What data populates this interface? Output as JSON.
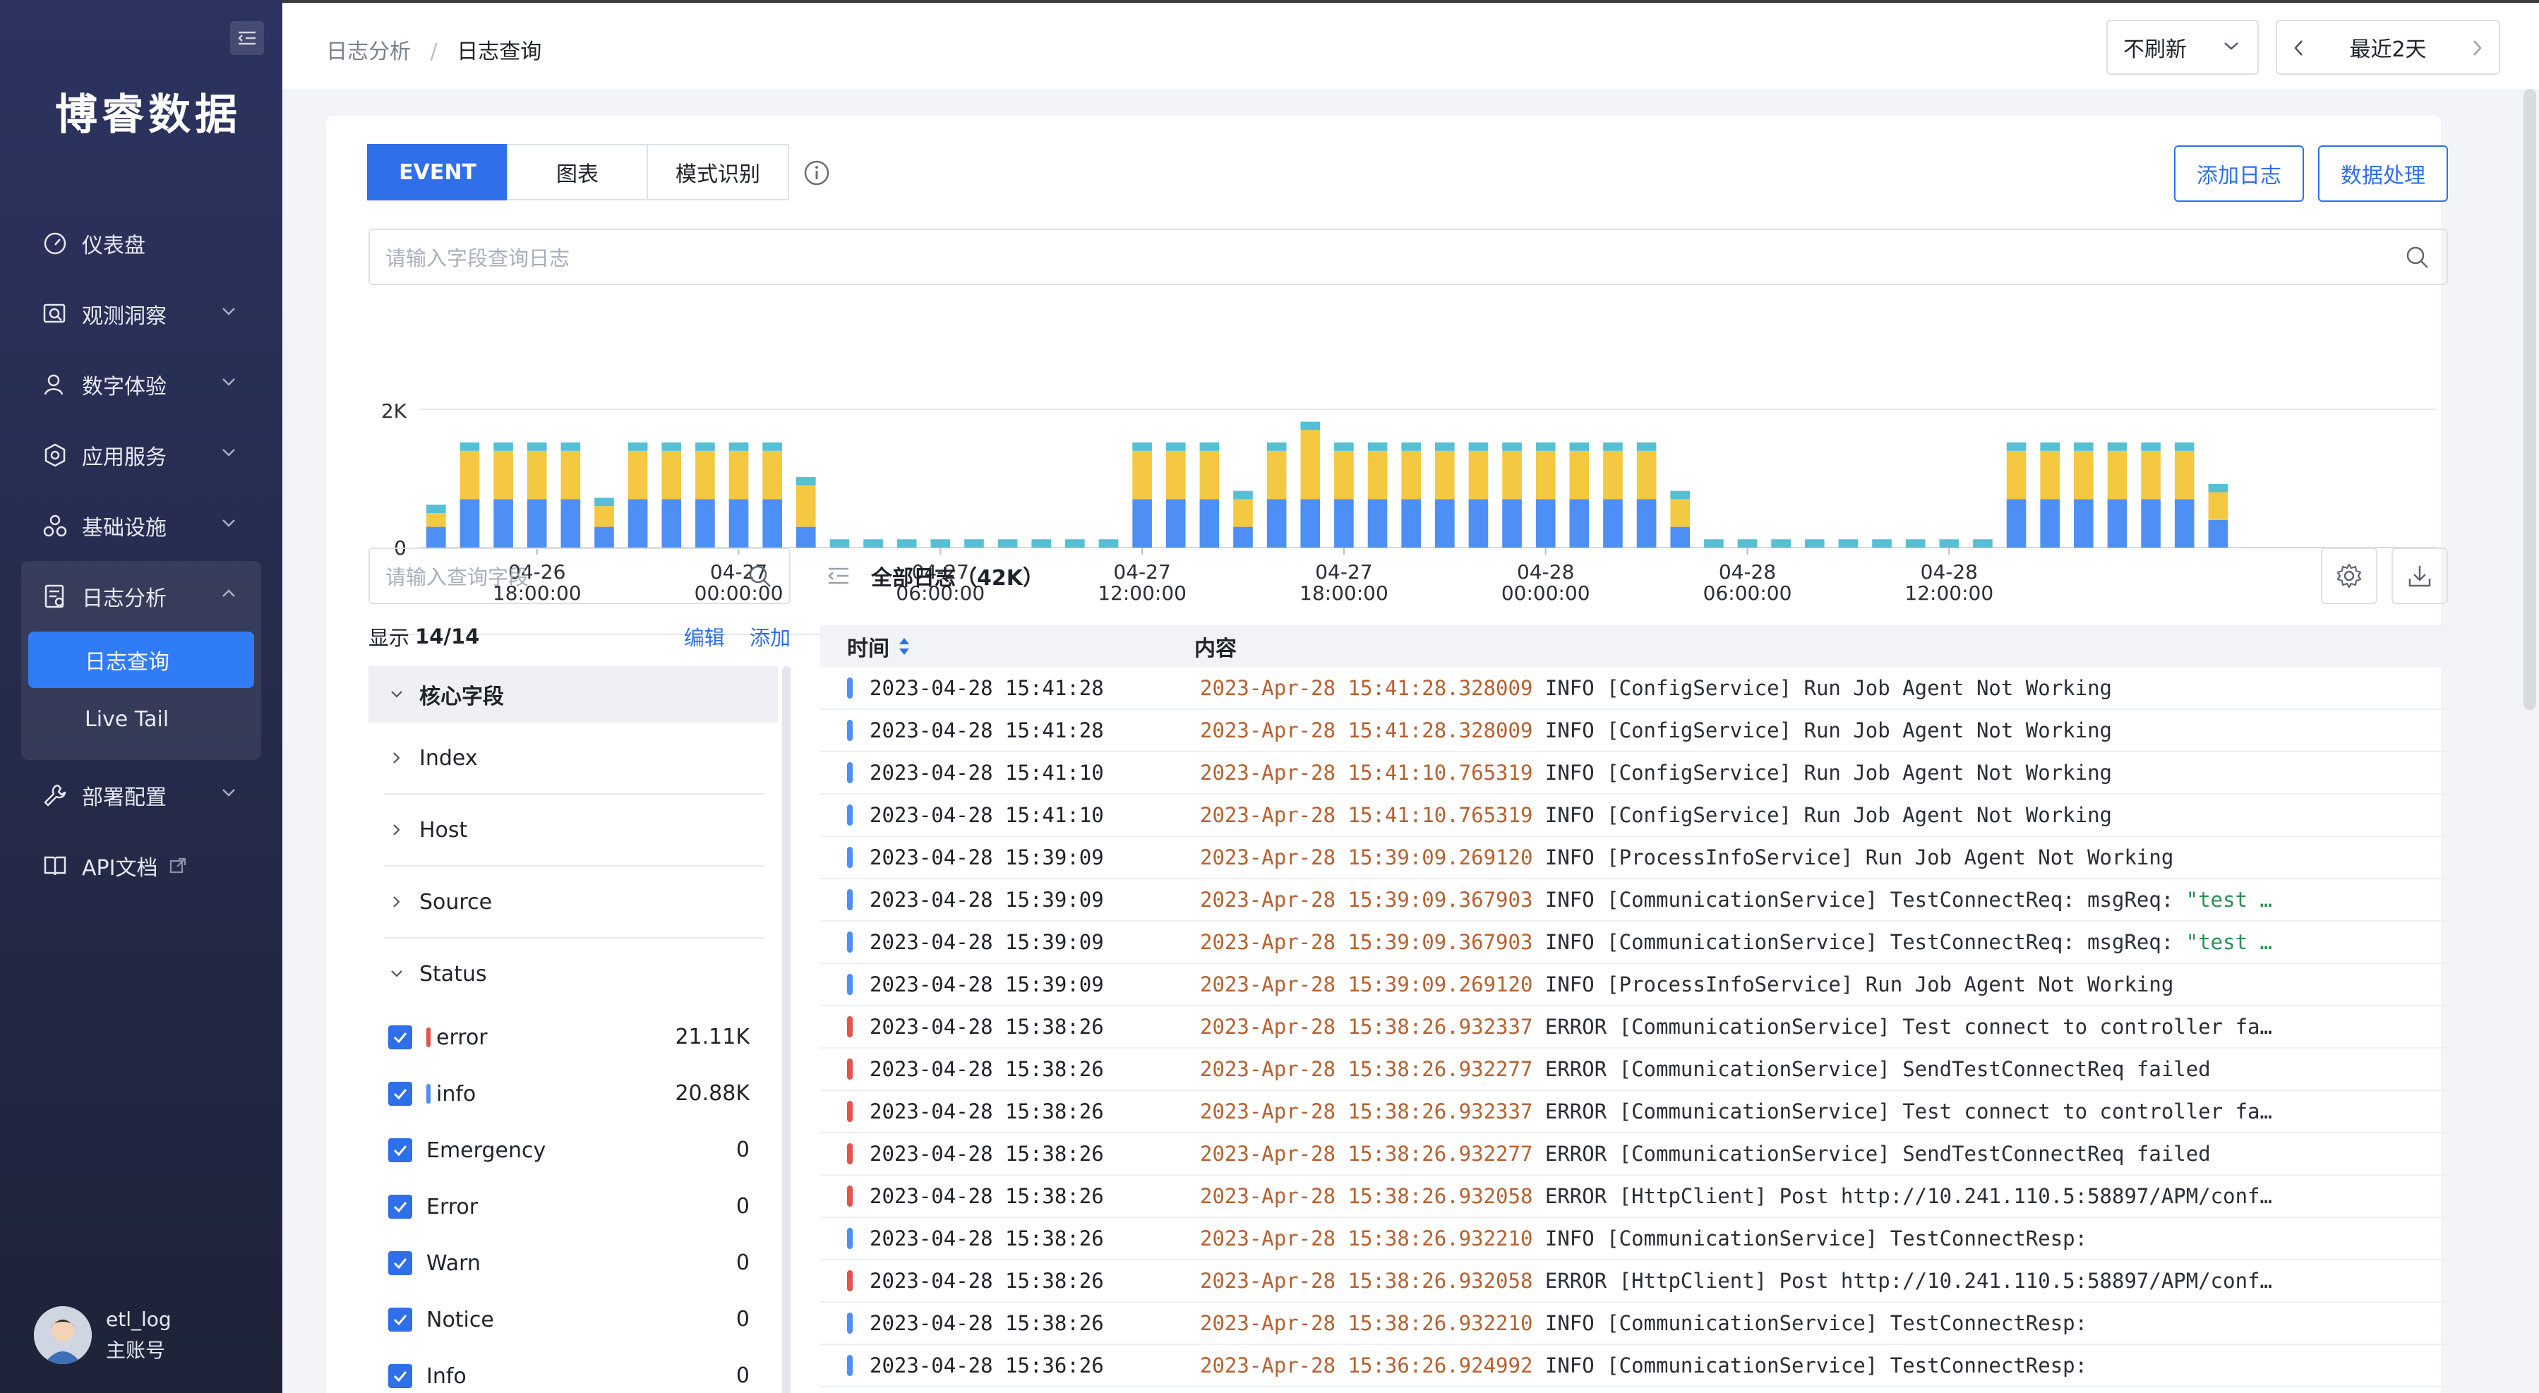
{
  "sidebar": {
    "brand": "博睿数据",
    "items": [
      {
        "label": "仪表盘",
        "icon": "gauge-icon"
      },
      {
        "label": "观测洞察",
        "icon": "search-chart-icon"
      },
      {
        "label": "数字体验",
        "icon": "user-icon"
      },
      {
        "label": "应用服务",
        "icon": "app-service-icon"
      },
      {
        "label": "基础设施",
        "icon": "infrastructure-icon"
      },
      {
        "label": "日志分析",
        "icon": "log-icon"
      },
      {
        "label": "部署配置",
        "icon": "wrench-icon"
      },
      {
        "label": "API文档",
        "icon": "book-icon"
      }
    ],
    "sub_items": [
      {
        "label": "日志查询"
      },
      {
        "label": "Live Tail"
      }
    ],
    "user": {
      "name": "etl_log",
      "role": "主账号"
    }
  },
  "header": {
    "breadcrumb": [
      "日志分析",
      "日志查询"
    ],
    "refresh": "不刷新",
    "range": "最近2天"
  },
  "tabs": [
    "EVENT",
    "图表",
    "模式识别"
  ],
  "buttons": {
    "add_log": "添加日志",
    "process": "数据处理"
  },
  "search": {
    "placeholder": "请输入字段查询日志"
  },
  "chart_data": {
    "type": "bar",
    "stacked": true,
    "ylim": [
      0,
      2000
    ],
    "yticks": [
      "0",
      "2K"
    ],
    "xticks": [
      {
        "date": "04-26",
        "time": "18:00:00",
        "index": 3
      },
      {
        "date": "04-27",
        "time": "00:00:00",
        "index": 9
      },
      {
        "date": "04-27",
        "time": "06:00:00",
        "index": 15
      },
      {
        "date": "04-27",
        "time": "12:00:00",
        "index": 21
      },
      {
        "date": "04-27",
        "time": "18:00:00",
        "index": 27
      },
      {
        "date": "04-28",
        "time": "00:00:00",
        "index": 33
      },
      {
        "date": "04-28",
        "time": "06:00:00",
        "index": 39
      },
      {
        "date": "04-28",
        "time": "12:00:00",
        "index": 45
      }
    ],
    "series": [
      {
        "color": "#4e8ff5",
        "values": [
          300,
          700,
          700,
          700,
          700,
          300,
          700,
          700,
          700,
          700,
          700,
          300,
          0,
          0,
          0,
          0,
          0,
          0,
          0,
          0,
          0,
          700,
          700,
          700,
          300,
          700,
          700,
          700,
          700,
          700,
          700,
          700,
          700,
          700,
          700,
          700,
          700,
          300,
          0,
          0,
          0,
          0,
          0,
          0,
          0,
          0,
          0,
          700,
          700,
          700,
          700,
          700,
          700,
          400,
          0,
          0,
          0,
          0,
          0,
          0
        ]
      },
      {
        "color": "#f5c842",
        "values": [
          200,
          700,
          700,
          700,
          700,
          300,
          700,
          700,
          700,
          700,
          700,
          600,
          0,
          0,
          0,
          0,
          0,
          0,
          0,
          0,
          0,
          700,
          700,
          700,
          400,
          700,
          1000,
          700,
          700,
          700,
          700,
          700,
          700,
          700,
          700,
          700,
          700,
          400,
          0,
          0,
          0,
          0,
          0,
          0,
          0,
          0,
          0,
          700,
          700,
          700,
          700,
          700,
          700,
          400,
          0,
          0,
          0,
          0,
          0,
          0
        ]
      },
      {
        "color": "#55bfd4",
        "values": [
          120,
          120,
          120,
          120,
          120,
          120,
          120,
          120,
          120,
          120,
          120,
          120,
          120,
          120,
          120,
          120,
          120,
          120,
          120,
          120,
          120,
          120,
          120,
          120,
          120,
          120,
          120,
          120,
          120,
          120,
          120,
          120,
          120,
          120,
          120,
          120,
          120,
          120,
          120,
          120,
          120,
          120,
          120,
          120,
          120,
          120,
          120,
          120,
          120,
          120,
          120,
          120,
          120,
          120,
          0,
          0,
          0,
          0,
          0,
          0
        ]
      }
    ]
  },
  "field_panel": {
    "search_placeholder": "请输入查询字段",
    "show_label": "显示",
    "show_count": "14/14",
    "edit": "编辑",
    "add": "添加",
    "group_title": "核心字段",
    "fields": [
      "Index",
      "Host",
      "Source",
      "Status"
    ],
    "status_items": [
      {
        "label": "error",
        "count": "21.11K",
        "color": "#e5534b"
      },
      {
        "label": "info",
        "count": "20.88K",
        "color": "#4e8ff5"
      },
      {
        "label": "Emergency",
        "count": "0",
        "color": ""
      },
      {
        "label": "Error",
        "count": "0",
        "color": ""
      },
      {
        "label": "Warn",
        "count": "0",
        "color": ""
      },
      {
        "label": "Notice",
        "count": "0",
        "color": ""
      },
      {
        "label": "Info",
        "count": "0",
        "color": ""
      }
    ]
  },
  "log_panel": {
    "title": "全部日志（42K）",
    "columns": [
      "时间",
      "内容"
    ],
    "rows": [
      {
        "level": "info",
        "ts": "2023-04-28 15:41:28",
        "dt": "2023-Apr-28 15:41:28.328009",
        "text": " INFO [ConfigService] Run Job Agent Not Working",
        "str": ""
      },
      {
        "level": "info",
        "ts": "2023-04-28 15:41:28",
        "dt": "2023-Apr-28 15:41:28.328009",
        "text": " INFO [ConfigService] Run Job Agent Not Working",
        "str": ""
      },
      {
        "level": "info",
        "ts": "2023-04-28 15:41:10",
        "dt": "2023-Apr-28 15:41:10.765319",
        "text": " INFO [ConfigService] Run Job Agent Not Working",
        "str": ""
      },
      {
        "level": "info",
        "ts": "2023-04-28 15:41:10",
        "dt": "2023-Apr-28 15:41:10.765319",
        "text": " INFO [ConfigService] Run Job Agent Not Working",
        "str": ""
      },
      {
        "level": "info",
        "ts": "2023-04-28 15:39:09",
        "dt": "2023-Apr-28 15:39:09.269120",
        "text": " INFO [ProcessInfoService] Run Job Agent Not Working",
        "str": ""
      },
      {
        "level": "info",
        "ts": "2023-04-28 15:39:09",
        "dt": "2023-Apr-28 15:39:09.367903",
        "text": " INFO [CommunicationService] TestConnectReq: msgReq: ",
        "str": "\"test …"
      },
      {
        "level": "info",
        "ts": "2023-04-28 15:39:09",
        "dt": "2023-Apr-28 15:39:09.367903",
        "text": " INFO [CommunicationService] TestConnectReq: msgReq: ",
        "str": "\"test …"
      },
      {
        "level": "info",
        "ts": "2023-04-28 15:39:09",
        "dt": "2023-Apr-28 15:39:09.269120",
        "text": " INFO [ProcessInfoService] Run Job Agent Not Working",
        "str": ""
      },
      {
        "level": "error",
        "ts": "2023-04-28 15:38:26",
        "dt": "2023-Apr-28 15:38:26.932337",
        "text": " ERROR [CommunicationService] Test connect to controller fa…",
        "str": ""
      },
      {
        "level": "error",
        "ts": "2023-04-28 15:38:26",
        "dt": "2023-Apr-28 15:38:26.932277",
        "text": " ERROR [CommunicationService] SendTestConnectReq failed",
        "str": ""
      },
      {
        "level": "error",
        "ts": "2023-04-28 15:38:26",
        "dt": "2023-Apr-28 15:38:26.932337",
        "text": " ERROR [CommunicationService] Test connect to controller fa…",
        "str": ""
      },
      {
        "level": "error",
        "ts": "2023-04-28 15:38:26",
        "dt": "2023-Apr-28 15:38:26.932277",
        "text": " ERROR [CommunicationService] SendTestConnectReq failed",
        "str": ""
      },
      {
        "level": "error",
        "ts": "2023-04-28 15:38:26",
        "dt": "2023-Apr-28 15:38:26.932058",
        "text": " ERROR [HttpClient] Post http://10.241.110.5:58897/APM/conf…",
        "str": ""
      },
      {
        "level": "info",
        "ts": "2023-04-28 15:38:26",
        "dt": "2023-Apr-28 15:38:26.932210",
        "text": " INFO [CommunicationService] TestConnectResp:",
        "str": ""
      },
      {
        "level": "error",
        "ts": "2023-04-28 15:38:26",
        "dt": "2023-Apr-28 15:38:26.932058",
        "text": " ERROR [HttpClient] Post http://10.241.110.5:58897/APM/conf…",
        "str": ""
      },
      {
        "level": "info",
        "ts": "2023-04-28 15:38:26",
        "dt": "2023-Apr-28 15:38:26.932210",
        "text": " INFO [CommunicationService] TestConnectResp:",
        "str": ""
      },
      {
        "level": "info",
        "ts": "2023-04-28 15:36:26",
        "dt": "2023-Apr-28 15:36:26.924992",
        "text": " INFO [CommunicationService] TestConnectResp:",
        "str": ""
      }
    ]
  },
  "colors": {
    "primary": "#2f6fe9",
    "error": "#e5534b",
    "info": "#4e8ff5"
  }
}
